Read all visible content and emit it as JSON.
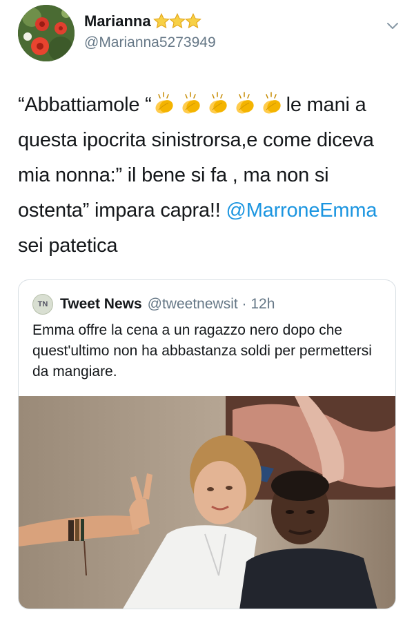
{
  "tweet": {
    "author_name": "Marianna",
    "author_handle": "@Marianna5273949",
    "text_part1": "“Abbattiamole “",
    "text_part2": "le mani a questa ipocrita sinistrorsa,e come diceva mia nonna:” il bene si fa , ma non si ostenta” impara capra!! ",
    "mention": "@MarroneEmma",
    "text_part3": " sei patetica",
    "star_icon": "star-icon",
    "clap_icon": "clapping-hands-icon",
    "caret_icon": "chevron-down-icon"
  },
  "quoted_tweet": {
    "avatar_text": "TN",
    "author_name": "Tweet News",
    "author_handle": "@tweetnewsit",
    "separator": " · ",
    "time": "12h",
    "text": "Emma offre la cena a un ragazzo nero dopo che quest'ultimo non ha abbastanza soldi per permettersi da mangiare."
  },
  "colors": {
    "link": "#1b95e0",
    "secondary_text": "#657786",
    "border": "#d8dfe4",
    "star": "#f5c518"
  }
}
